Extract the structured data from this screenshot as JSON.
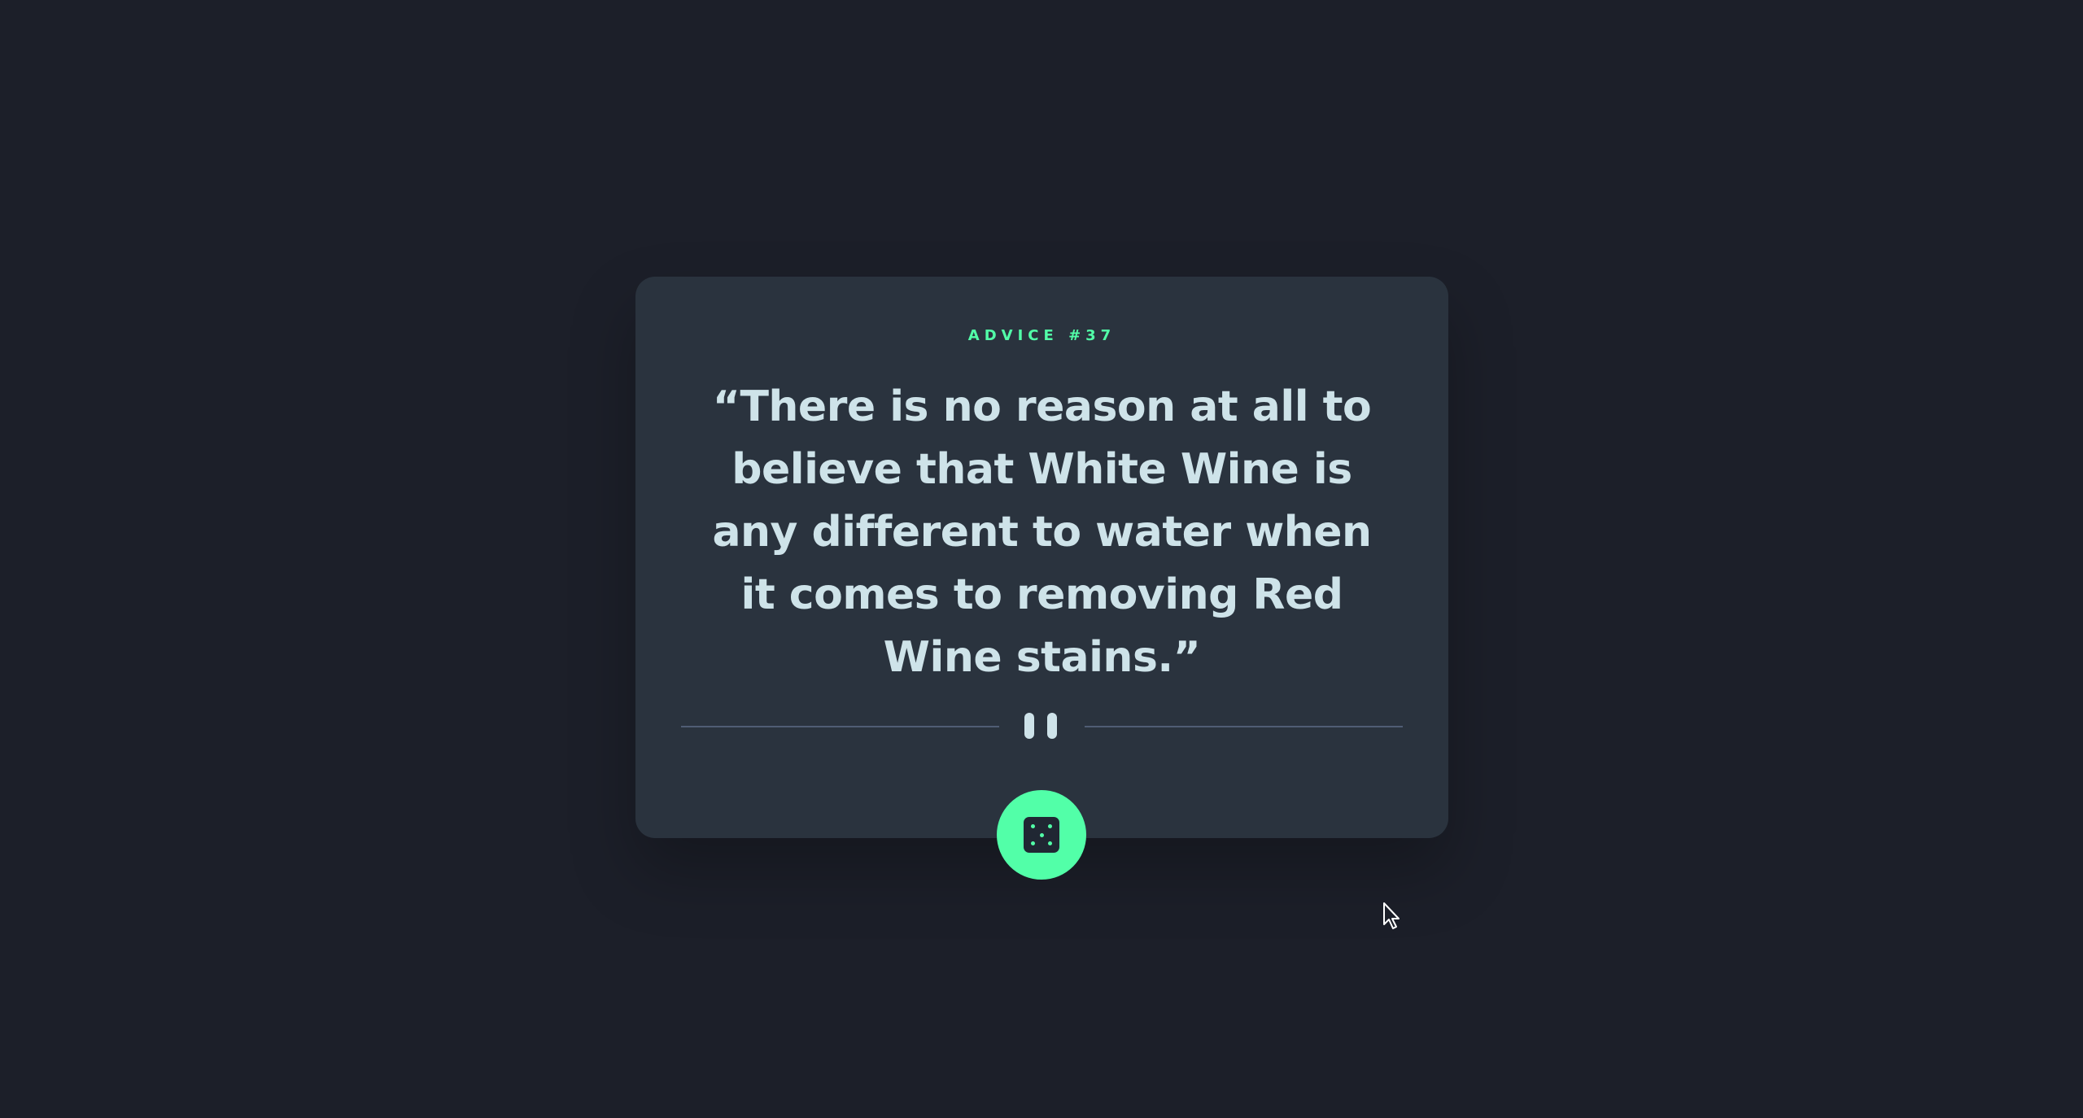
{
  "advice": {
    "label": "ADVICE #37",
    "quote": "“There is no reason at all to believe that White Wine is any different to water when it comes to removing Red Wine stains.”"
  },
  "divider": {
    "icon": "pause-icon"
  },
  "button": {
    "icon": "dice-icon"
  },
  "colors": {
    "background": "#1c1f29",
    "card": "#2a333e",
    "accent": "#52ffa8",
    "text": "#cee3e9",
    "divider": "#4f5d74"
  }
}
